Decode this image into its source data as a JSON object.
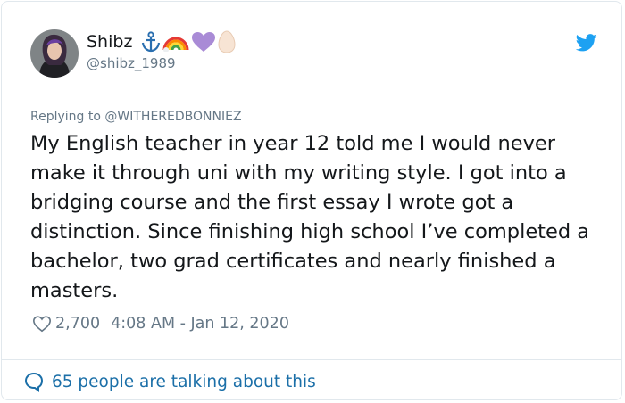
{
  "tweet": {
    "author_name": "Shibz",
    "author_handle": "@shibz_1989",
    "author_emojis": [
      "anchor",
      "rainbow",
      "purple-heart",
      "egg"
    ],
    "reply_prefix": "Replying to",
    "reply_to": "@WITHEREDBONNIEZ",
    "text": "My English teacher in year 12 told me I would never make it through uni with my writing style. I got into a bridging course and the first essay I wrote got a distinction. Since finishing high school I’ve completed a bachelor, two grad certificates and nearly finished a masters.",
    "likes": "2,700",
    "timestamp": "4:08 AM - Jan 12, 2020",
    "talking": "65 people are talking about this"
  },
  "colors": {
    "text": "#14171a",
    "muted": "#657786",
    "brand": "#1da1f2",
    "link": "#1b6fa8",
    "border": "#e1e8ed"
  }
}
